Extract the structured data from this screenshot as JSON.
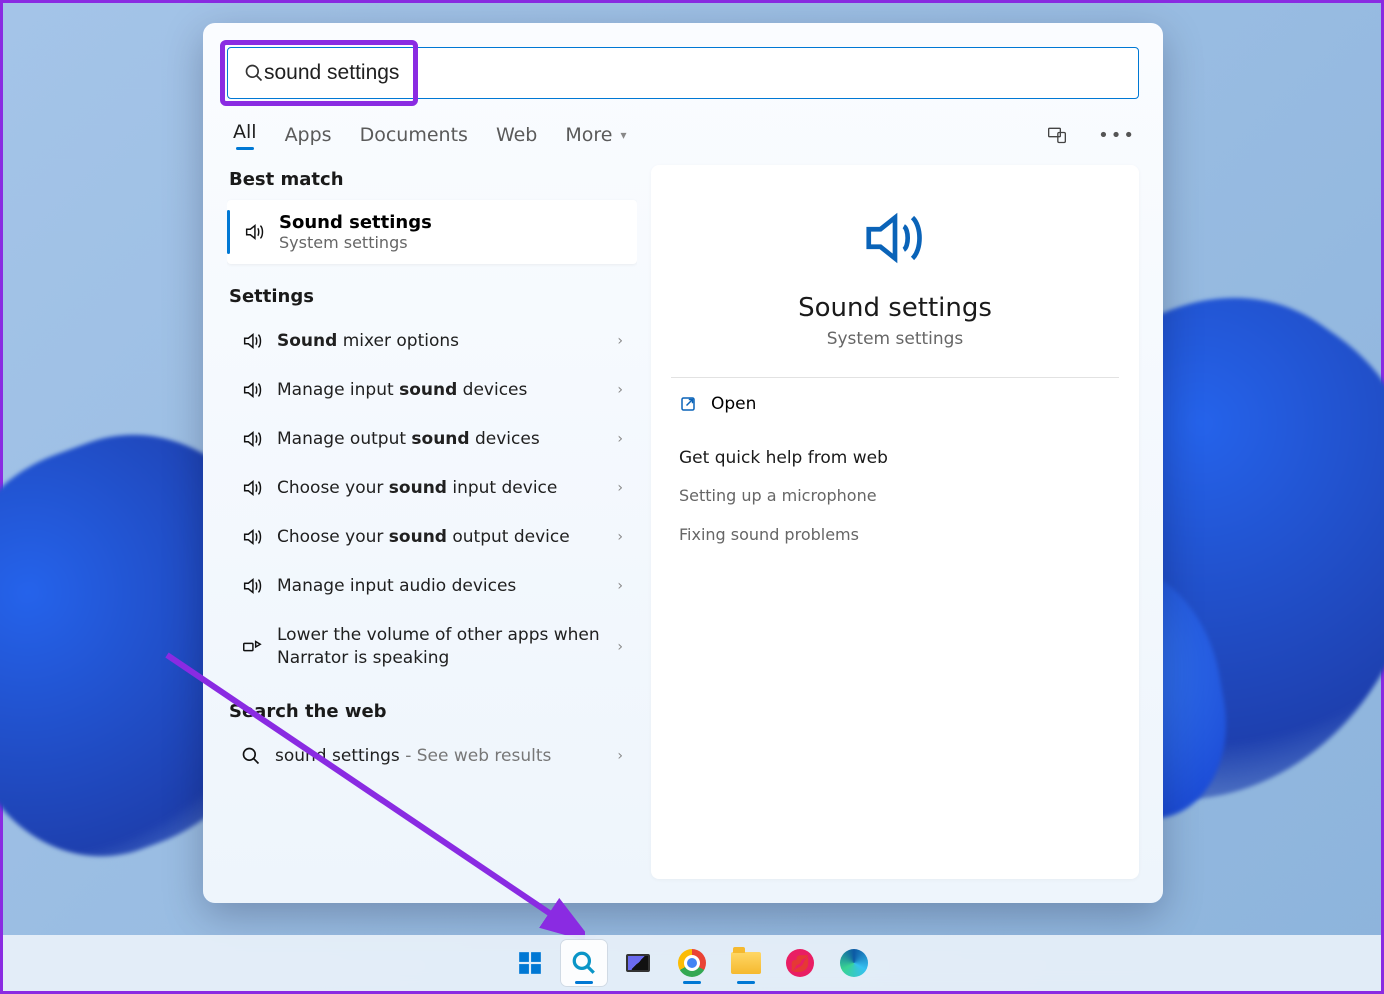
{
  "search": {
    "value": "sound settings"
  },
  "filters": {
    "all": "All",
    "apps": "Apps",
    "documents": "Documents",
    "web": "Web",
    "more": "More"
  },
  "sections": {
    "best_match": "Best match",
    "settings": "Settings",
    "search_web": "Search the web"
  },
  "best_match": {
    "title": "Sound settings",
    "subtitle": "System settings"
  },
  "settings_items": [
    {
      "pre": "",
      "bold": "Sound",
      "post": " mixer options"
    },
    {
      "pre": "Manage input ",
      "bold": "sound",
      "post": " devices"
    },
    {
      "pre": "Manage output ",
      "bold": "sound",
      "post": " devices"
    },
    {
      "pre": "Choose your ",
      "bold": "sound",
      "post": " input device"
    },
    {
      "pre": "Choose your ",
      "bold": "sound",
      "post": " output device"
    },
    {
      "pre": "Manage input audio devices",
      "bold": "",
      "post": ""
    },
    {
      "pre": "Lower the volume of other apps when Narrator is speaking",
      "bold": "",
      "post": ""
    }
  ],
  "web_item": {
    "term": "sound settings",
    "hint": " - See web results"
  },
  "preview": {
    "title": "Sound settings",
    "subtitle": "System settings",
    "open": "Open",
    "help_header": "Get quick help from web",
    "help_links": [
      "Setting up a microphone",
      "Fixing sound problems"
    ]
  },
  "taskbar": {
    "items": [
      "start",
      "search",
      "taskview",
      "chrome",
      "explorer",
      "lips",
      "edge"
    ]
  },
  "annotation": {
    "highlight_color": "#8a2be2"
  }
}
